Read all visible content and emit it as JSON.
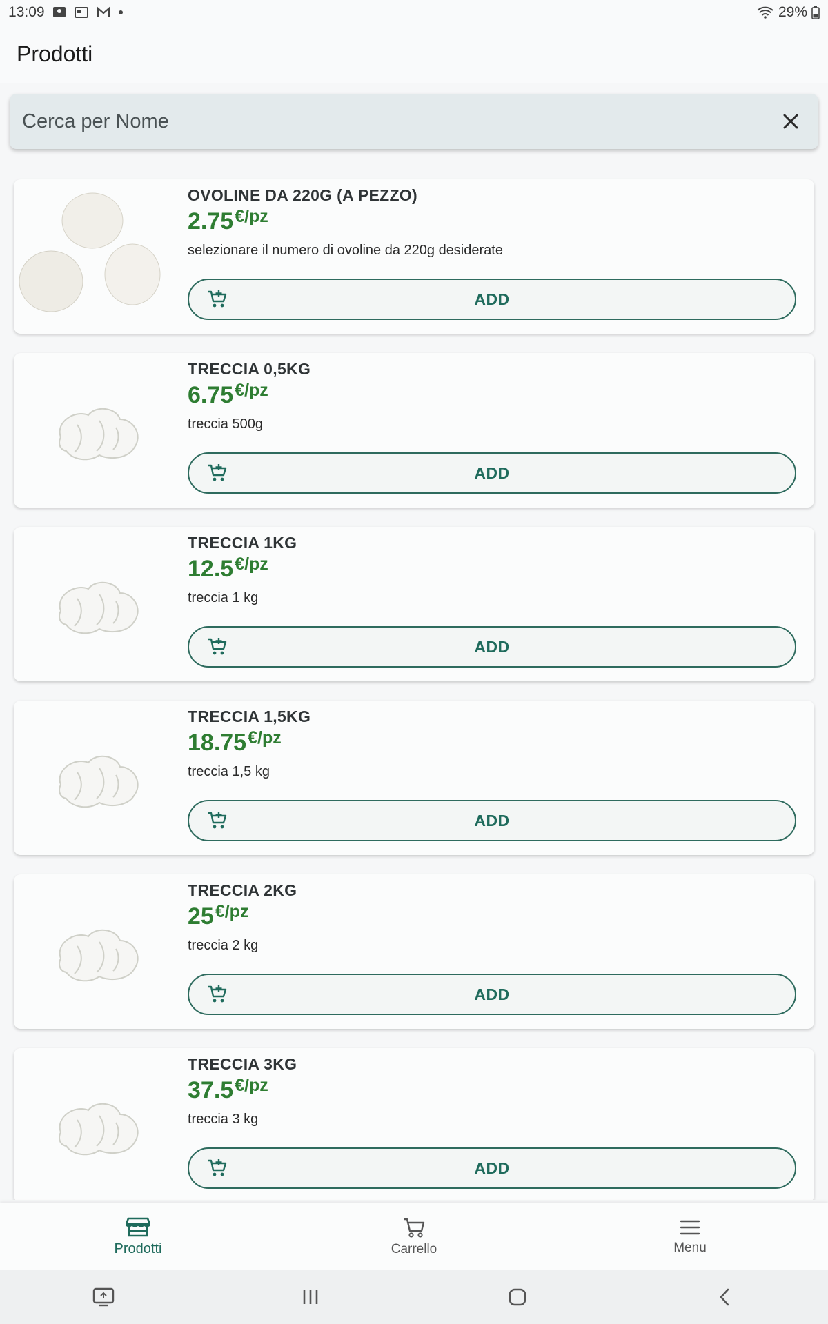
{
  "status_bar": {
    "time": "13:09",
    "battery": "29%",
    "left_icons": [
      "notification-icon",
      "calendar-icon",
      "gmail-icon",
      "dot-icon"
    ],
    "right_icons": [
      "wifi-icon",
      "battery-icon"
    ]
  },
  "app_bar": {
    "title": "Prodotti"
  },
  "search": {
    "placeholder": "Cerca per Nome",
    "value": "",
    "clear_icon": "close-icon"
  },
  "products": [
    {
      "name": "OVOLINE DA 220G (A PEZZO)",
      "price": "2.75",
      "unit": "€/pz",
      "description": "selezionare il numero di ovoline da 220g desiderate",
      "add_label": "ADD",
      "image": "ovoline"
    },
    {
      "name": "TRECCIA 0,5KG",
      "price": "6.75",
      "unit": "€/pz",
      "description": "treccia 500g",
      "add_label": "ADD",
      "image": "treccia"
    },
    {
      "name": "TRECCIA 1KG",
      "price": "12.5",
      "unit": "€/pz",
      "description": "treccia 1 kg",
      "add_label": "ADD",
      "image": "treccia"
    },
    {
      "name": "TRECCIA 1,5KG",
      "price": "18.75",
      "unit": "€/pz",
      "description": "treccia 1,5 kg",
      "add_label": "ADD",
      "image": "treccia"
    },
    {
      "name": "TRECCIA 2KG",
      "price": "25",
      "unit": "€/pz",
      "description": "treccia 2 kg",
      "add_label": "ADD",
      "image": "treccia"
    },
    {
      "name": "TRECCIA 3KG",
      "price": "37.5",
      "unit": "€/pz",
      "description": "treccia 3 kg",
      "add_label": "ADD",
      "image": "treccia"
    }
  ],
  "bottom_nav": {
    "items": [
      {
        "label": "Prodotti",
        "icon": "store-icon",
        "active": true
      },
      {
        "label": "Carrello",
        "icon": "cart-icon",
        "active": false
      },
      {
        "label": "Menu",
        "icon": "menu-icon",
        "active": false
      }
    ]
  },
  "colors": {
    "accent": "#1f6b5c",
    "price": "#2e7d32",
    "search_bg": "#e3eaec"
  }
}
